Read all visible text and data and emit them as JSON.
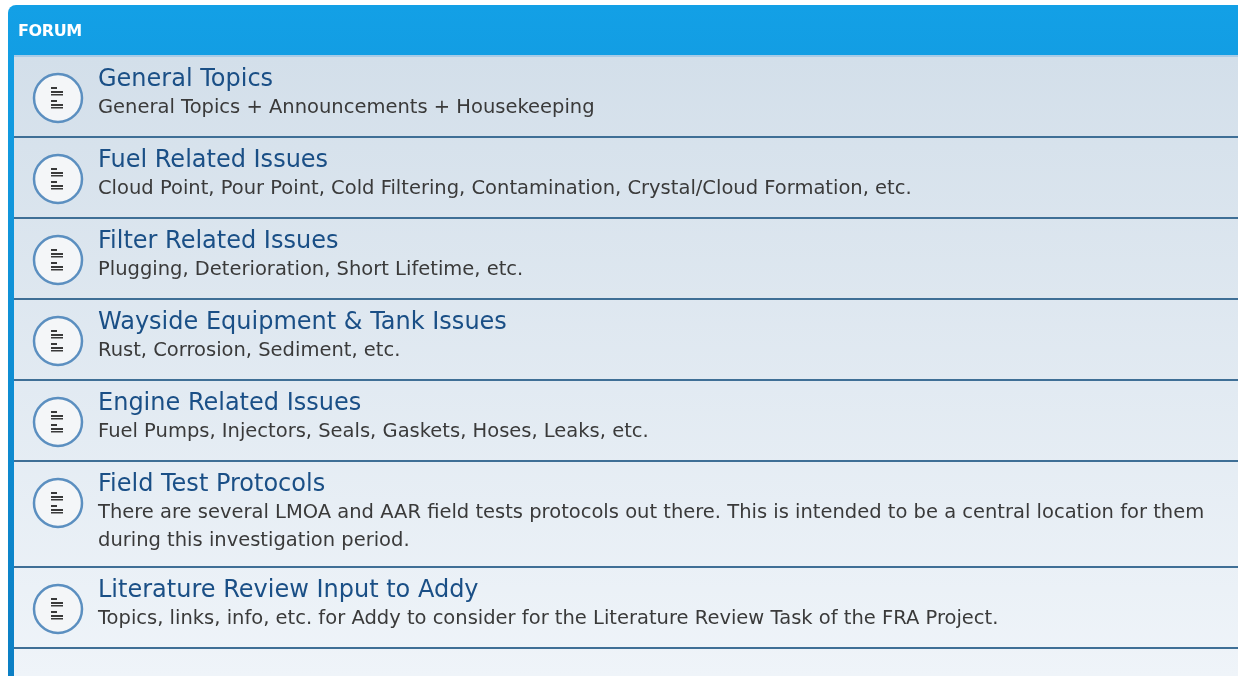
{
  "forum": {
    "title": "FORUM",
    "topics": [
      {
        "title": "General Topics",
        "description": "General Topics + Announcements + Housekeeping"
      },
      {
        "title": "Fuel Related Issues",
        "description": "Cloud Point, Pour Point, Cold Filtering, Contamination, Crystal/Cloud Formation, etc."
      },
      {
        "title": "Filter Related Issues",
        "description": "Plugging, Deterioration, Short Lifetime, etc."
      },
      {
        "title": "Wayside Equipment & Tank Issues",
        "description": "Rust, Corrosion, Sediment, etc."
      },
      {
        "title": "Engine Related Issues",
        "description": "Fuel Pumps, Injectors, Seals, Gaskets, Hoses, Leaks, etc."
      },
      {
        "title": "Field Test Protocols",
        "description": "There are several LMOA and AAR field tests protocols out there. This is intended to be a central location for them during this investigation period."
      },
      {
        "title": "Literature Review Input to Addy",
        "description": "Topics, links, info, etc. for Addy to consider for the Literature Review Task of the FRA Project."
      }
    ]
  }
}
